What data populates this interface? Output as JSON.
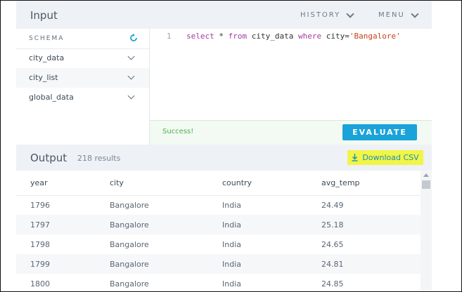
{
  "input": {
    "title": "Input",
    "history_label": "HISTORY",
    "menu_label": "MENU"
  },
  "schema": {
    "label": "SCHEMA",
    "refresh_icon": "refresh-icon",
    "items": [
      {
        "label": "city_data"
      },
      {
        "label": "city_list"
      },
      {
        "label": "global_data"
      }
    ]
  },
  "editor": {
    "line_number": "1",
    "query": "select * from city_data where city='Bangalore'"
  },
  "status": {
    "message": "Success!",
    "evaluate_label": "EVALUATE"
  },
  "output": {
    "title": "Output",
    "results_count": "218 results",
    "download_label": "Download CSV"
  },
  "table": {
    "columns": [
      "year",
      "city",
      "country",
      "avg_temp"
    ],
    "rows": [
      [
        "1796",
        "Bangalore",
        "India",
        "24.49"
      ],
      [
        "1797",
        "Bangalore",
        "India",
        "25.18"
      ],
      [
        "1798",
        "Bangalore",
        "India",
        "24.65"
      ],
      [
        "1799",
        "Bangalore",
        "India",
        "24.81"
      ],
      [
        "1800",
        "Bangalore",
        "India",
        "24.85"
      ]
    ]
  },
  "colors": {
    "accent": "#1aa3d9",
    "success": "#4caf50",
    "highlight": "#f1f545"
  }
}
